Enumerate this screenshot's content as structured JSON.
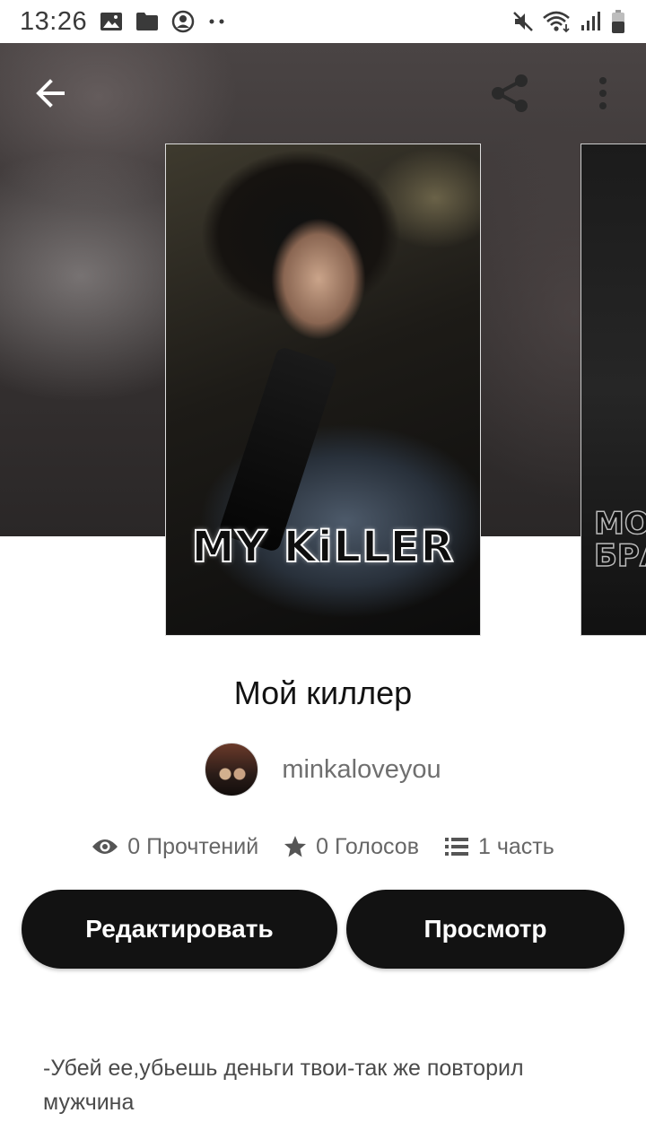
{
  "status_bar": {
    "time": "13:26",
    "left_icons": [
      "image-icon",
      "folder-icon",
      "account-circle-icon",
      "more-dots-icon"
    ],
    "right_icons": [
      "mute-icon",
      "wifi-icon",
      "signal-icon",
      "battery-icon"
    ]
  },
  "toolbar": {
    "back_icon": "arrow-left-icon",
    "share_icon": "share-icon",
    "more_icon": "more-vert-icon"
  },
  "covers": {
    "main_title": "MY KiLLER",
    "next_title": "MO\nБРА"
  },
  "story": {
    "title": "Мой киллер",
    "author": "minkaloveyou",
    "stats": {
      "reads": "0 Прочтений",
      "votes": "0 Голосов",
      "parts": "1 часть"
    }
  },
  "actions": {
    "edit_label": "Редактировать",
    "view_label": "Просмотр"
  },
  "description": "-Убей ее,убьешь деньги твои-так же повторил мужчина",
  "colors": {
    "button_bg": "#121212",
    "button_text": "#ffffff",
    "title_text": "#121212",
    "secondary_text": "#666666"
  }
}
